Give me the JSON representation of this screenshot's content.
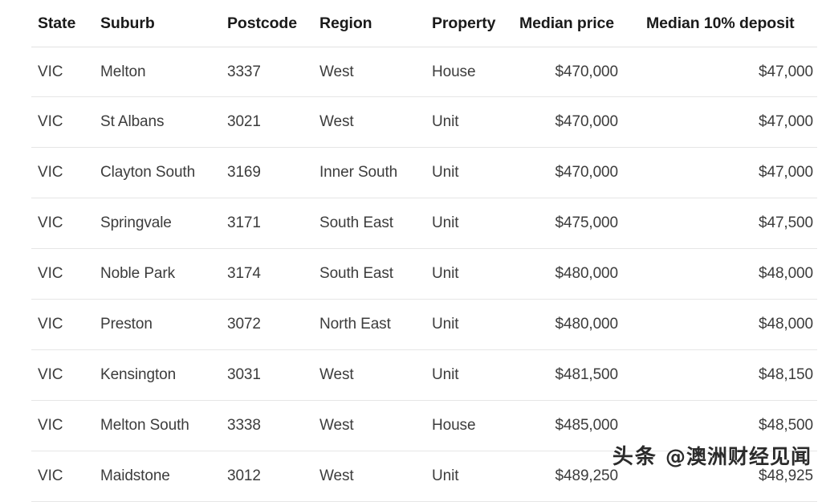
{
  "table": {
    "columns": [
      {
        "key": "state",
        "label": "State"
      },
      {
        "key": "suburb",
        "label": "Suburb"
      },
      {
        "key": "postcode",
        "label": "Postcode"
      },
      {
        "key": "region",
        "label": "Region"
      },
      {
        "key": "property",
        "label": "Property"
      },
      {
        "key": "price",
        "label": "Median price"
      },
      {
        "key": "deposit",
        "label": "Median 10% deposit"
      }
    ],
    "rows": [
      {
        "state": "VIC",
        "suburb": "Melton",
        "postcode": "3337",
        "region": "West",
        "property": "House",
        "price": "$470,000",
        "deposit": "$47,000"
      },
      {
        "state": "VIC",
        "suburb": "St Albans",
        "postcode": "3021",
        "region": "West",
        "property": "Unit",
        "price": "$470,000",
        "deposit": "$47,000"
      },
      {
        "state": "VIC",
        "suburb": "Clayton South",
        "postcode": "3169",
        "region": "Inner South",
        "property": "Unit",
        "price": "$470,000",
        "deposit": "$47,000"
      },
      {
        "state": "VIC",
        "suburb": "Springvale",
        "postcode": "3171",
        "region": "South East",
        "property": "Unit",
        "price": "$475,000",
        "deposit": "$47,500"
      },
      {
        "state": "VIC",
        "suburb": "Noble Park",
        "postcode": "3174",
        "region": "South East",
        "property": "Unit",
        "price": "$480,000",
        "deposit": "$48,000"
      },
      {
        "state": "VIC",
        "suburb": "Preston",
        "postcode": "3072",
        "region": "North East",
        "property": "Unit",
        "price": "$480,000",
        "deposit": "$48,000"
      },
      {
        "state": "VIC",
        "suburb": "Kensington",
        "postcode": "3031",
        "region": "West",
        "property": "Unit",
        "price": "$481,500",
        "deposit": "$48,150"
      },
      {
        "state": "VIC",
        "suburb": "Melton South",
        "postcode": "3338",
        "region": "West",
        "property": "House",
        "price": "$485,000",
        "deposit": "$48,500"
      },
      {
        "state": "VIC",
        "suburb": "Maidstone",
        "postcode": "3012",
        "region": "West",
        "property": "Unit",
        "price": "$489,250",
        "deposit": "$48,925"
      }
    ]
  },
  "watermark": {
    "logo": "头条",
    "handle": "@澳洲财经见闻"
  },
  "colors": {
    "header_text": "#1a1a1a",
    "body_text": "#3c3c3c",
    "row_divider": "#e6e6e6",
    "background": "#ffffff"
  }
}
